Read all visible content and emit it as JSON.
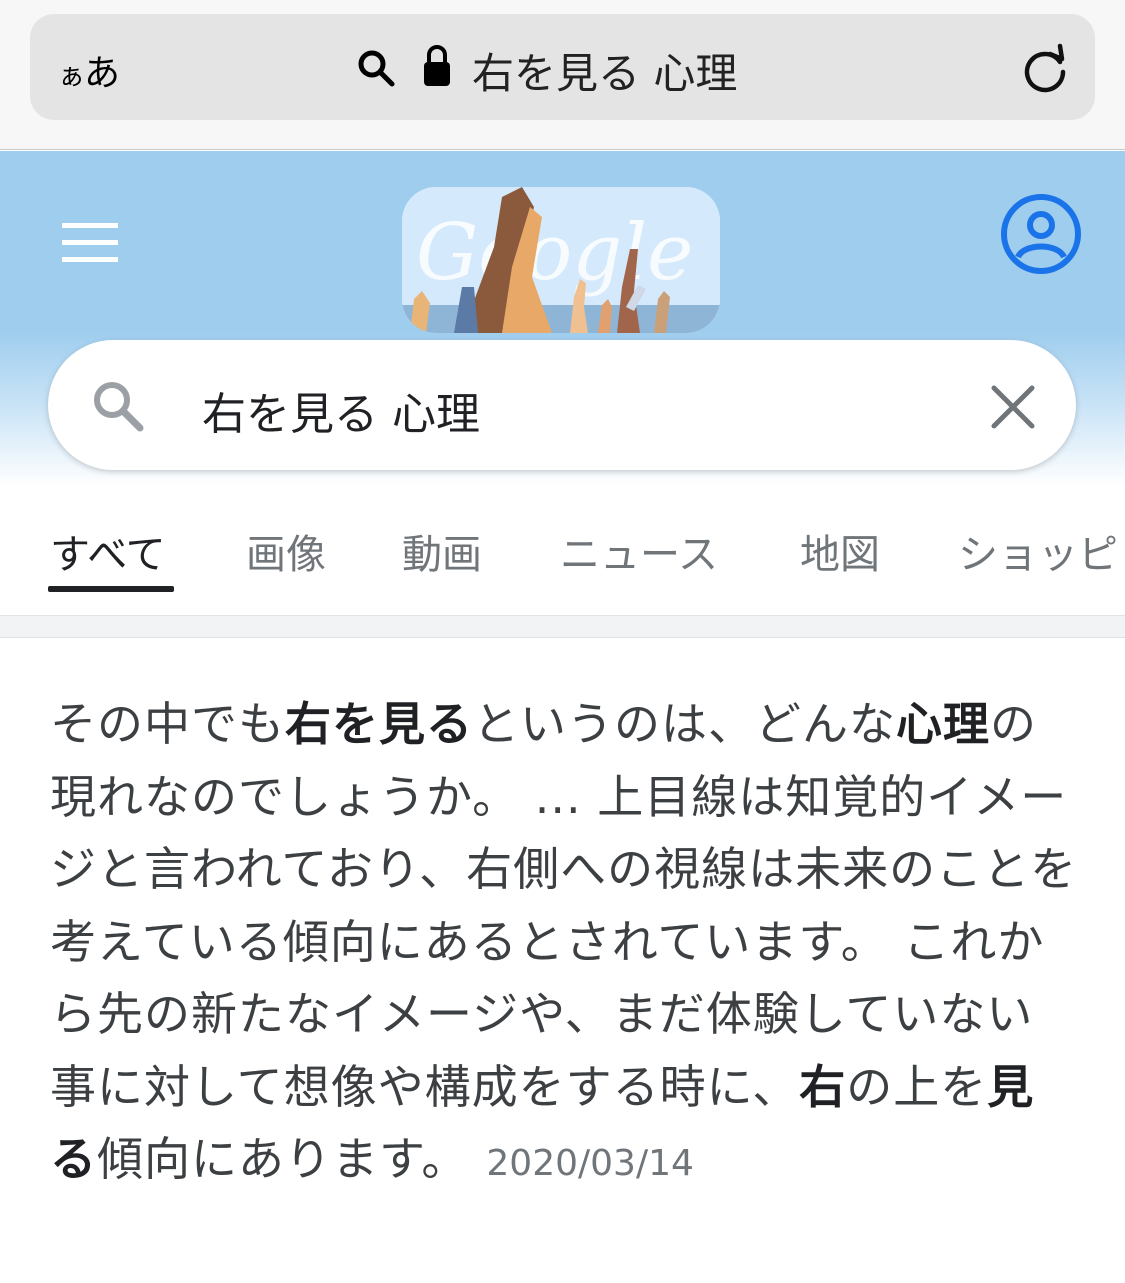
{
  "browser": {
    "text_size_label_small": "ぁ",
    "text_size_label_large": "あ",
    "address_text": "右を見る 心理",
    "icons": [
      "search-icon",
      "lock-icon",
      "reload-icon"
    ]
  },
  "header": {
    "doodle_text": "Google",
    "icons": [
      "menu-icon",
      "account-icon"
    ],
    "bg_color": "#9fcdee"
  },
  "search": {
    "query": "右を見る 心理",
    "icons": [
      "search-icon",
      "clear-icon"
    ]
  },
  "tabs": [
    {
      "label": "すべて",
      "active": true
    },
    {
      "label": "画像",
      "active": false
    },
    {
      "label": "動画",
      "active": false
    },
    {
      "label": "ニュース",
      "active": false
    },
    {
      "label": "地図",
      "active": false
    },
    {
      "label": "ショッピ",
      "active": false
    }
  ],
  "snippet": {
    "segments": [
      {
        "text": "その中でも",
        "bold": false
      },
      {
        "text": "右を見る",
        "bold": true
      },
      {
        "text": "というのは、どんな",
        "bold": false
      },
      {
        "text": "心理",
        "bold": true
      },
      {
        "text": "の現れなのでしょうか。 ... 上目線は知覚的イメージと言われており、右側への視線は未来のことを考えている傾向にあるとされています。 これから先の新たなイメージや、まだ体験していない事に対して想像や構成をする時に、",
        "bold": false
      },
      {
        "text": "右",
        "bold": true
      },
      {
        "text": "の上を",
        "bold": false
      },
      {
        "text": "見る",
        "bold": true
      },
      {
        "text": "傾向にあります。",
        "bold": false
      }
    ],
    "date": "2020/03/14"
  }
}
